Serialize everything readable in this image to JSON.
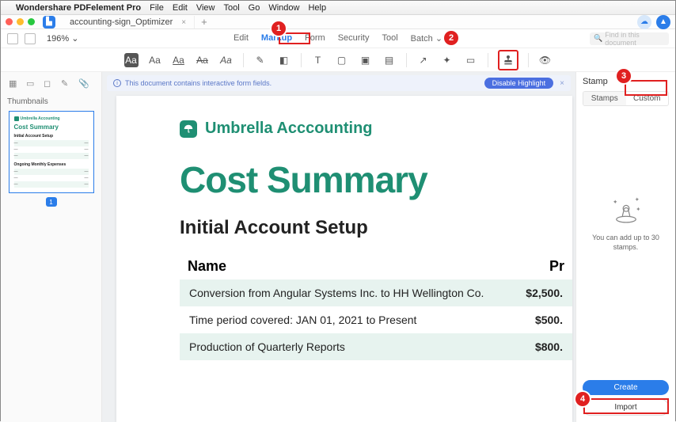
{
  "menubar": {
    "app": "Wondershare PDFelement Pro",
    "items": [
      "File",
      "Edit",
      "View",
      "Tool",
      "Go",
      "Window",
      "Help"
    ]
  },
  "titlebar": {
    "tab": "accounting-sign_Optimizer",
    "close": "×",
    "plus": "+"
  },
  "toolbar1": {
    "zoom": "196% ",
    "arrow": "⌄",
    "menu": {
      "edit": "Edit",
      "markup": "Markup",
      "form": "Form",
      "security": "Security",
      "tool": "Tool",
      "batch": "Batch ⌄"
    },
    "search_placeholder": "Find in this document"
  },
  "toolbar2": {
    "labels": [
      "Aa",
      "Aa",
      "Aa",
      "Aa",
      "Aa"
    ]
  },
  "banner": {
    "msg": "This document contains interactive form fields.",
    "btn": "Disable Highlight",
    "x": "×"
  },
  "left": {
    "title": "Thumbnails",
    "page": "1",
    "thumb": {
      "brand": "Umbrella Accounting",
      "h1": "Cost Summary",
      "h2a": "Initial Account Setup",
      "h2b": "Ongoing Monthly Expenses"
    }
  },
  "doc": {
    "brand": "Umbrella Acccounting",
    "h1": "Cost Summary",
    "h2": "Initial Account Setup",
    "colName": "Name",
    "colPrice": "Pr",
    "rows": [
      {
        "name": "Conversion from Angular Systems Inc. to HH Wellington Co.",
        "price": "$2,500."
      },
      {
        "name": "Time period covered: JAN 01, 2021 to Present",
        "price": "$500."
      },
      {
        "name": "Production of Quarterly Reports",
        "price": "$800."
      }
    ]
  },
  "right": {
    "title": "Stamp",
    "tabStamps": "Stamps",
    "tabCustom": "Custom",
    "empty": "You can add up to 30 stamps.",
    "create": "Create",
    "import": "Import"
  },
  "callouts": {
    "c1": "1",
    "c2": "2",
    "c3": "3",
    "c4": "4"
  }
}
